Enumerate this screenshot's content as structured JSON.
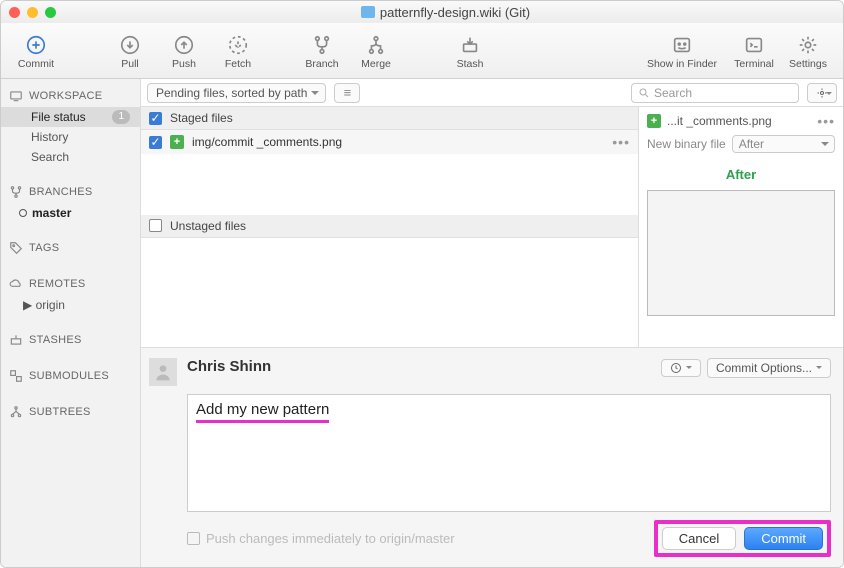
{
  "titlebar": {
    "title": "patternfly-design.wiki (Git)"
  },
  "toolbar": {
    "commit": "Commit",
    "pull": "Pull",
    "push": "Push",
    "fetch": "Fetch",
    "branch": "Branch",
    "merge": "Merge",
    "stash": "Stash",
    "show_in_finder": "Show in Finder",
    "terminal": "Terminal",
    "settings": "Settings"
  },
  "sidebar": {
    "workspace": "WORKSPACE",
    "file_status": "File status",
    "file_status_count": "1",
    "history": "History",
    "search": "Search",
    "branches": "BRANCHES",
    "master": "master",
    "tags": "TAGS",
    "remotes": "REMOTES",
    "origin": "origin",
    "stashes": "STASHES",
    "submodules": "SUBMODULES",
    "subtrees": "SUBTREES"
  },
  "filterbar": {
    "filter": "Pending files, sorted by path",
    "search_placeholder": "Search"
  },
  "files": {
    "staged_header": "Staged files",
    "unstaged_header": "Unstaged files",
    "staged_item": "img/commit _comments.png"
  },
  "preview": {
    "filename": "...it _comments.png",
    "newbinary": "New binary file",
    "after_select": "After",
    "after_label": "After"
  },
  "commit": {
    "author": "Chris Shinn",
    "options": "Commit Options...",
    "message": "Add my new pattern",
    "push_label": "Push changes immediately to origin/master",
    "cancel": "Cancel",
    "commit": "Commit"
  }
}
